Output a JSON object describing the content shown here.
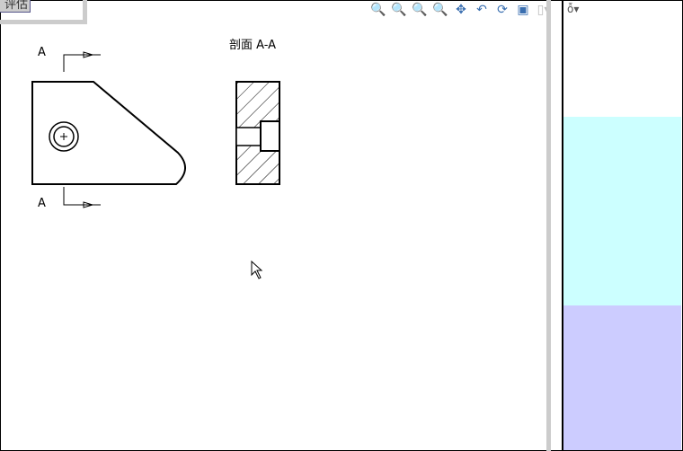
{
  "popup": {
    "button_label": "评估"
  },
  "toolbar": {
    "icons": [
      "zoom-to-fit-icon",
      "zoom-to-area-icon",
      "zoom-in-out-icon",
      "zoom-to-selection-icon",
      "pan-icon",
      "previous-view-icon",
      "rotate-icon",
      "view-settings-icon",
      "display-style-icon"
    ]
  },
  "drawing": {
    "section_label_top": "A",
    "section_label_bottom": "A",
    "section_view_title": "剖面 A-A"
  },
  "right_panel": {
    "icons": [
      "glasses-icon"
    ],
    "colors": {
      "cyan": "#ccffff",
      "lavender": "#ccccff"
    }
  }
}
